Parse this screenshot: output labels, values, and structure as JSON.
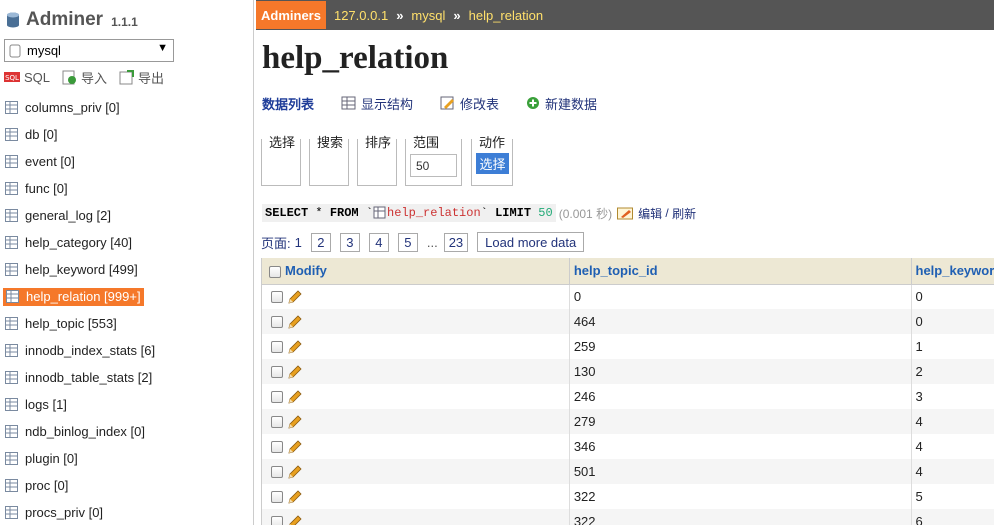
{
  "app": {
    "name": "Adminer",
    "version": "1.1.1"
  },
  "db_select": {
    "value": "mysql"
  },
  "tools": {
    "sql": "SQL",
    "import": "导入",
    "export": "导出"
  },
  "sidebar": {
    "tables": [
      {
        "label": "columns_priv [0]"
      },
      {
        "label": "db [0]"
      },
      {
        "label": "event [0]"
      },
      {
        "label": "func [0]"
      },
      {
        "label": "general_log [2]"
      },
      {
        "label": "help_category [40]"
      },
      {
        "label": "help_keyword [499]"
      },
      {
        "label": "help_relation [999+]",
        "active": true
      },
      {
        "label": "help_topic [553]"
      },
      {
        "label": "innodb_index_stats [6]"
      },
      {
        "label": "innodb_table_stats [2]"
      },
      {
        "label": "logs [1]"
      },
      {
        "label": "ndb_binlog_index [0]"
      },
      {
        "label": "plugin [0]"
      },
      {
        "label": "proc [0]"
      },
      {
        "label": "procs_priv [0]"
      }
    ]
  },
  "breadcrumb": {
    "home": "Adminers",
    "server": "127.0.0.1",
    "sep": "»",
    "database": "mysql",
    "table": "help_relation"
  },
  "page": {
    "title": "help_relation"
  },
  "actions": {
    "data_list": "数据列表",
    "show_structure": "显示结构",
    "alter_table": "修改表",
    "new_item": "新建数据"
  },
  "filters": {
    "select": "选择",
    "search": "搜索",
    "sort": "排序",
    "limit": "范围",
    "limit_value": "50",
    "action": "动作",
    "action_button": "选择"
  },
  "query": {
    "select": "SELECT",
    "star": " * ",
    "from": "FROM",
    "table": "help_relation",
    "limit": "LIMIT",
    "limit_value": "50",
    "time": "(0.001 秒)",
    "edit": "编辑",
    "slash": " / ",
    "refresh": "刷新"
  },
  "pager": {
    "label": "页面:",
    "current": "1",
    "pages": [
      "2",
      "3",
      "4",
      "5"
    ],
    "dots": "...",
    "last": "23",
    "load_more": "Load more data"
  },
  "grid": {
    "columns": {
      "modify": "Modify",
      "c1": "help_topic_id",
      "c2": "help_keyword_id"
    },
    "rows": [
      {
        "c1": "0",
        "c2": "0"
      },
      {
        "c1": "464",
        "c2": "0"
      },
      {
        "c1": "259",
        "c2": "1"
      },
      {
        "c1": "130",
        "c2": "2"
      },
      {
        "c1": "246",
        "c2": "3"
      },
      {
        "c1": "279",
        "c2": "4"
      },
      {
        "c1": "346",
        "c2": "4"
      },
      {
        "c1": "501",
        "c2": "4"
      },
      {
        "c1": "322",
        "c2": "5"
      },
      {
        "c1": "322",
        "c2": "6"
      }
    ]
  },
  "colors": {
    "accent": "#f5782a",
    "topbar": "#555555",
    "link": "#22337a",
    "header_bg": "#ede8d4"
  }
}
